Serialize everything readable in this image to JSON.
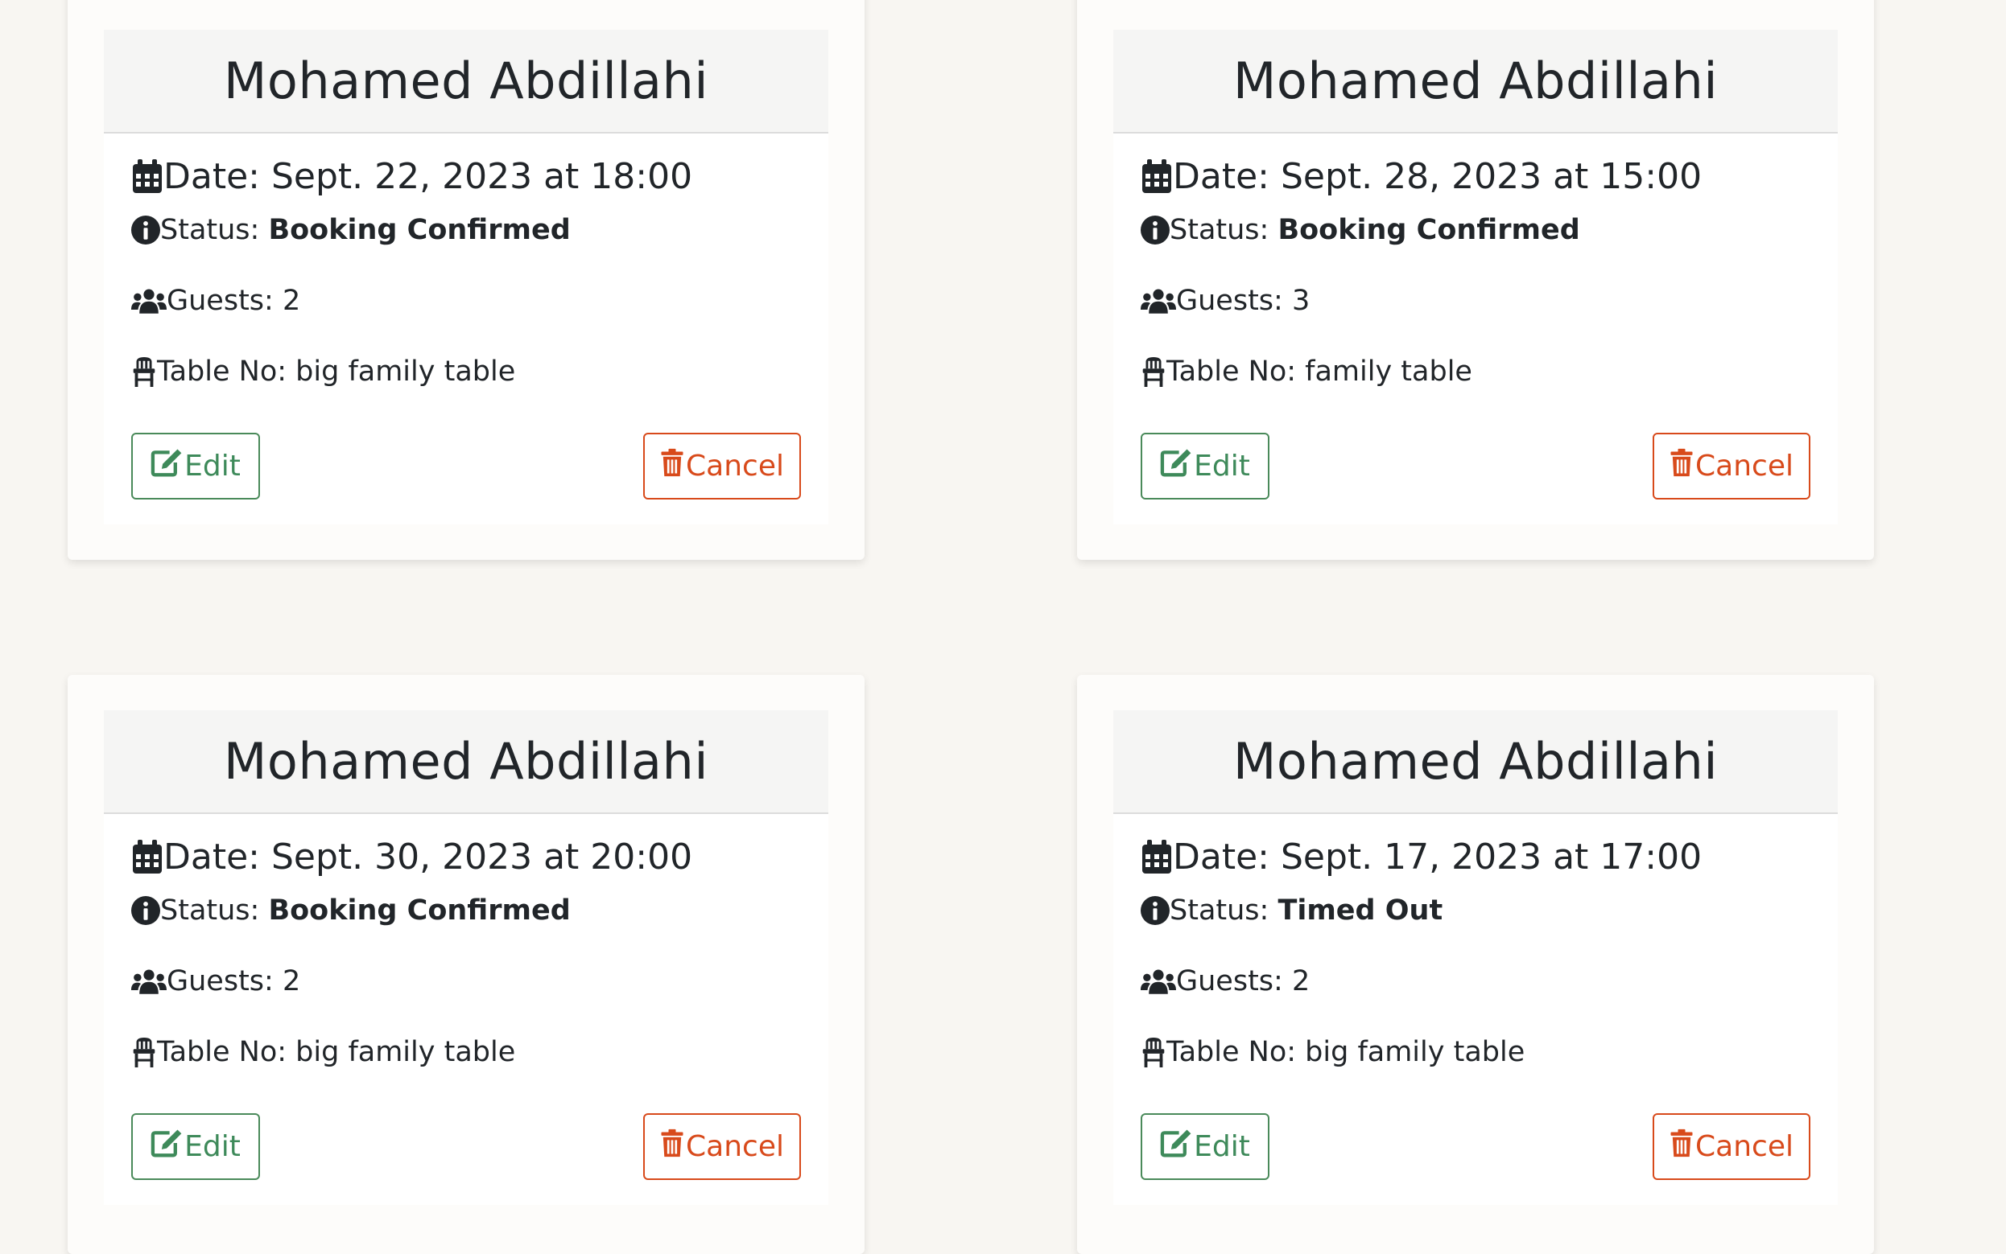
{
  "labels": {
    "date_prefix": "Date: ",
    "status_prefix": "Status: ",
    "guests_prefix": "Guests: ",
    "table_prefix": "Table No: ",
    "edit": "Edit",
    "cancel": "Cancel"
  },
  "colors": {
    "edit": "#3e8a5a",
    "cancel": "#d84a1b",
    "page_background": "#f8f6f2"
  },
  "icons": {
    "date": "calendar-icon",
    "status": "info-circle-icon",
    "guests": "users-icon",
    "table": "chair-icon",
    "edit": "edit-icon",
    "cancel": "trash-icon"
  },
  "bookings": [
    {
      "name": "Mohamed Abdillahi",
      "date": "Sept. 22, 2023 at 18:00",
      "status": "Booking Confirmed",
      "guests": "2",
      "table": "big family table"
    },
    {
      "name": "Mohamed Abdillahi",
      "date": "Sept. 28, 2023 at 15:00",
      "status": "Booking Confirmed",
      "guests": "3",
      "table": "family table"
    },
    {
      "name": "Mohamed Abdillahi",
      "date": "Sept. 30, 2023 at 20:00",
      "status": "Booking Confirmed",
      "guests": "2",
      "table": "big family table"
    },
    {
      "name": "Mohamed Abdillahi",
      "date": "Sept. 17, 2023 at 17:00",
      "status": "Timed Out",
      "guests": "2",
      "table": "big family table"
    }
  ]
}
